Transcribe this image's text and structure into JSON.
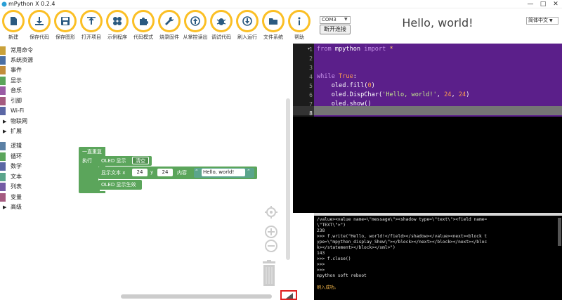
{
  "window": {
    "title": "mPython X 0.2.4",
    "minimize": "—",
    "maximize": "□",
    "close": "✕"
  },
  "toolbar": {
    "items": [
      {
        "label": "新建",
        "icon": "new-file-icon"
      },
      {
        "label": "保存代码",
        "icon": "save-code-icon"
      },
      {
        "label": "保存图形",
        "icon": "save-image-icon"
      },
      {
        "label": "打开项目",
        "icon": "open-project-icon"
      },
      {
        "label": "示例程序",
        "icon": "examples-icon"
      },
      {
        "label": "代码模式",
        "icon": "puzzle-icon"
      },
      {
        "label": "烧录固件",
        "icon": "wrench-icon"
      },
      {
        "label": "从掌控读出",
        "icon": "upload-icon"
      },
      {
        "label": "调试代码",
        "icon": "bug-icon"
      },
      {
        "label": "刷入运行",
        "icon": "download-icon"
      },
      {
        "label": "文件系统",
        "icon": "folder-icon"
      },
      {
        "label": "帮助",
        "icon": "info-icon"
      }
    ],
    "accent": "#fbbf24"
  },
  "connection": {
    "port": "COM3",
    "disconnect_label": "断开连接"
  },
  "header_title": "Hello, world!",
  "language": "简体中文",
  "sidebar": {
    "categories": [
      {
        "label": "常用命令",
        "color": "#c9a13a",
        "type": "bar"
      },
      {
        "label": "系统资源",
        "color": "#4a6fa5",
        "type": "bar"
      },
      {
        "label": "事件",
        "color": "#c28d3c",
        "type": "bar"
      },
      {
        "label": "显示",
        "color": "#5ba55b",
        "type": "bar"
      },
      {
        "label": "音乐",
        "color": "#9a5ca5",
        "type": "bar"
      },
      {
        "label": "引脚",
        "color": "#a55b80",
        "type": "bar"
      },
      {
        "label": "Wi-Fi",
        "color": "#5b67a5",
        "type": "bar"
      },
      {
        "label": "物联网",
        "color": "",
        "type": "tree"
      },
      {
        "label": "扩展",
        "color": "",
        "type": "tree"
      },
      {
        "label": "逻辑",
        "color": "#5b80a5",
        "type": "bar"
      },
      {
        "label": "循环",
        "color": "#5ba55b",
        "type": "bar"
      },
      {
        "label": "数学",
        "color": "#5b67a5",
        "type": "bar"
      },
      {
        "label": "文本",
        "color": "#5ba58c",
        "type": "bar"
      },
      {
        "label": "列表",
        "color": "#745ba5",
        "type": "bar"
      },
      {
        "label": "变量",
        "color": "#a55b80",
        "type": "bar"
      },
      {
        "label": "高级",
        "color": "",
        "type": "tree"
      }
    ]
  },
  "blocks": {
    "loop_label": "一直重复",
    "do_label": "执行",
    "oled_show_label": "OLED 显示",
    "clear_option": "清空",
    "display_text_label": "显示文本 x",
    "x_value": "24",
    "y_label": "y",
    "y_value": "24",
    "content_label": "内容",
    "text_value": "Hello, world!",
    "oled_show_effect_label": "OLED 显示生效",
    "loop_color": "#5ba55b",
    "oled_color": "#5ba55b"
  },
  "code": {
    "lines": [
      {
        "n": "1",
        "tokens": [
          {
            "t": "from ",
            "c": "#c792ea"
          },
          {
            "t": "mpython",
            "c": "#ffffff"
          },
          {
            "t": " import ",
            "c": "#c792ea"
          },
          {
            "t": "*",
            "c": "#ffcb6b"
          }
        ]
      },
      {
        "n": "2",
        "tokens": []
      },
      {
        "n": "3",
        "tokens": []
      },
      {
        "n": "4",
        "tokens": [
          {
            "t": "while ",
            "c": "#c792ea"
          },
          {
            "t": "True",
            "c": "#ff9d4d"
          },
          {
            "t": ":",
            "c": "#ffffff"
          }
        ]
      },
      {
        "n": "5",
        "tokens": [
          {
            "t": "    oled.fill(",
            "c": "#ffffff"
          },
          {
            "t": "0",
            "c": "#ff9d4d"
          },
          {
            "t": ")",
            "c": "#ffffff"
          }
        ]
      },
      {
        "n": "6",
        "tokens": [
          {
            "t": "    oled.DispChar(",
            "c": "#ffffff"
          },
          {
            "t": "'Hello, world!'",
            "c": "#c3e88d"
          },
          {
            "t": ", ",
            "c": "#ffffff"
          },
          {
            "t": "24",
            "c": "#ff9d4d"
          },
          {
            "t": ", ",
            "c": "#ffffff"
          },
          {
            "t": "24",
            "c": "#ff9d4d"
          },
          {
            "t": ")",
            "c": "#ffffff"
          }
        ]
      },
      {
        "n": "7",
        "tokens": [
          {
            "t": "    oled.show()",
            "c": "#ffffff"
          }
        ]
      },
      {
        "n": "8",
        "tokens": []
      }
    ],
    "active_line": "8"
  },
  "console": {
    "lines": [
      "/value><value name=\\\"message\\\"><shadow type=\\\"text\\\"><field name=",
      "\\\"TEXT\\\">\")",
      "238",
      ">>> f.write(\"Hello, world!</field></shadow></value><next><block t",
      "ype=\\\"mpython_display_Show\\\"></block></next></block></next></bloc",
      "k></statement></block></xml>\")",
      "143",
      ">>> f.close()",
      ">>>",
      ">>>",
      "mpython soft reboot",
      ""
    ],
    "status": "刷入成功。"
  }
}
